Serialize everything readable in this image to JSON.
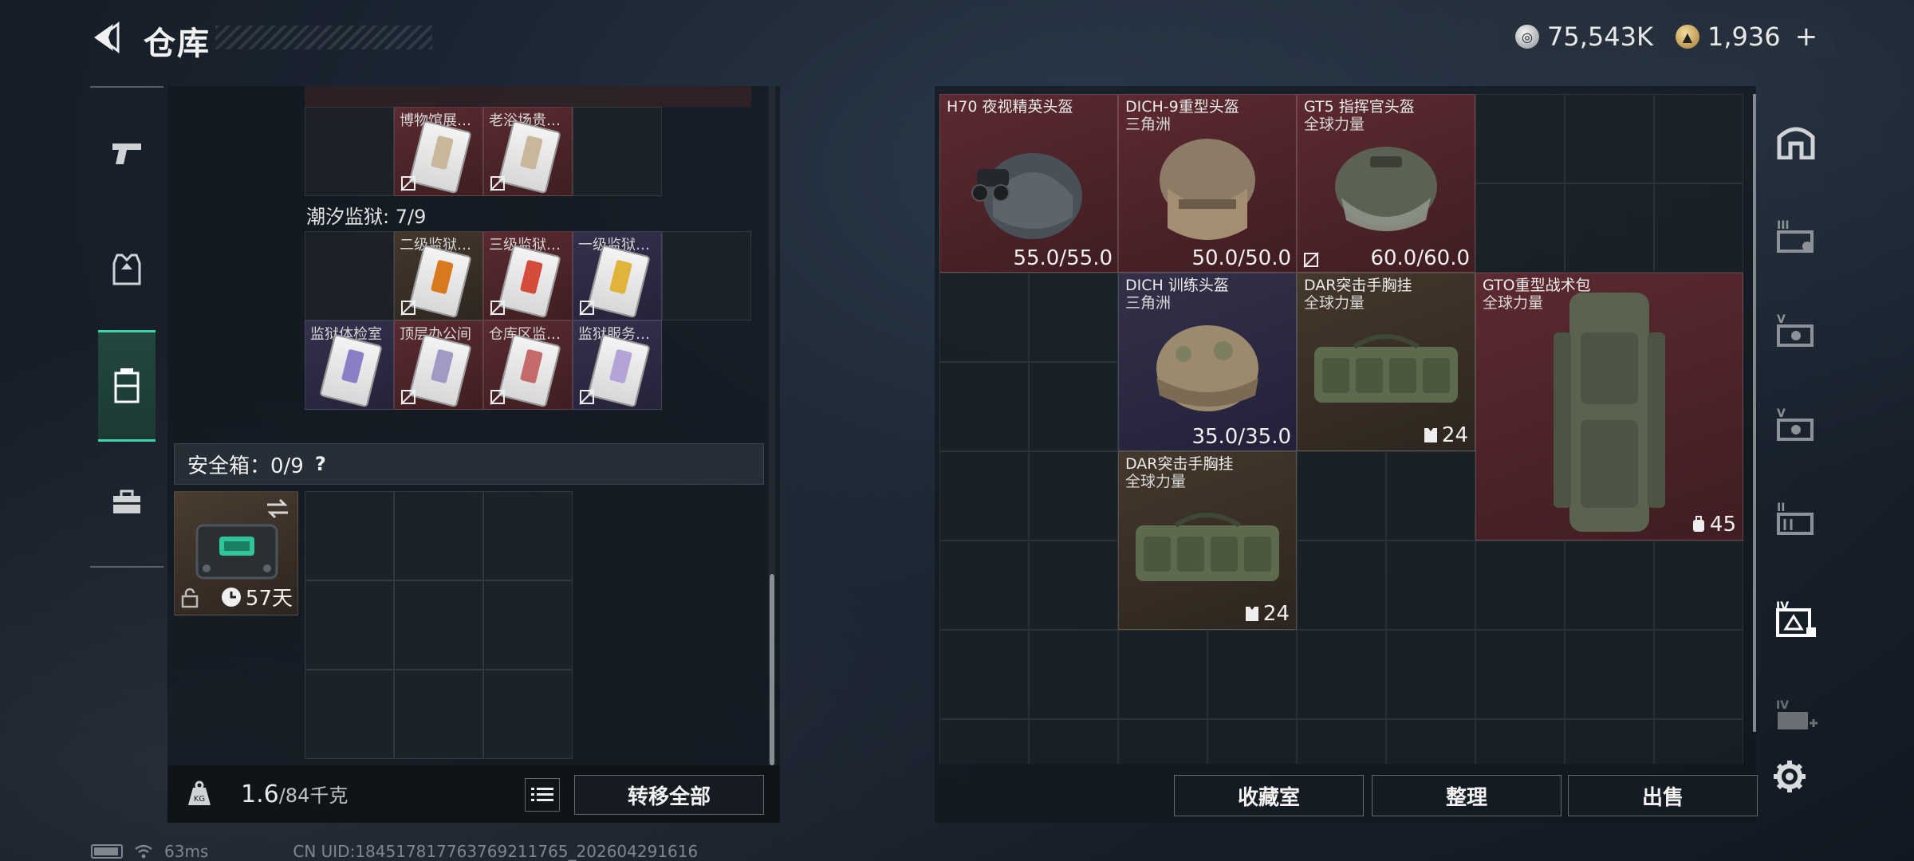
{
  "header": {
    "title": "仓库",
    "currency": [
      {
        "icon": "silver-coin-icon",
        "value": "75,543K"
      },
      {
        "icon": "gold-coin-icon",
        "value": "1,936"
      }
    ],
    "plus": "+"
  },
  "left_nav": [
    "weapons",
    "equipment",
    "storage",
    "toolbox"
  ],
  "storage": {
    "top_row": [
      {
        "name": "博物馆展…",
        "color": "red"
      },
      {
        "name": "老浴场贵…",
        "color": "red"
      }
    ],
    "prison_label": "潮汐监狱: 7/9",
    "prison_row1": [
      {
        "name": "二级监狱…",
        "color": "brown"
      },
      {
        "name": "三级监狱…",
        "color": "red"
      },
      {
        "name": "一级监狱…",
        "color": "purple"
      }
    ],
    "prison_row2": [
      {
        "name": "监狱体检室",
        "color": "purple"
      },
      {
        "name": "顶层办公间",
        "color": "red"
      },
      {
        "name": "仓库区监…",
        "color": "red"
      },
      {
        "name": "监狱服务…",
        "color": "purple"
      }
    ],
    "safebox": {
      "label": "安全箱：0/9",
      "help": "?",
      "days": "57天"
    }
  },
  "footer_left": {
    "weight_current": "1.6",
    "weight_max": "/84千克",
    "transfer_all": "转移全部"
  },
  "inventory": {
    "items": [
      {
        "name": "H70 夜视精英头盔",
        "sub": "",
        "value": "55.0/55.0",
        "color": "red",
        "kind": "helmet-nv"
      },
      {
        "name": "DICH-9重型头盔",
        "sub": "三角洲",
        "value": "50.0/50.0",
        "color": "red",
        "kind": "helmet-heavy"
      },
      {
        "name": "GT5 指挥官头盔",
        "sub": "全球力量",
        "value": "60.0/60.0",
        "color": "red",
        "kind": "helmet-cmd"
      },
      {
        "name": "DICH 训练头盔",
        "sub": "三角洲",
        "value": "35.0/35.0",
        "color": "purple",
        "kind": "helmet-train"
      },
      {
        "name": "DAR突击手胸挂",
        "sub": "全球力量",
        "value": "24",
        "color": "brown",
        "kind": "rig"
      },
      {
        "name": "GTO重型战术包",
        "sub": "全球力量",
        "value": "45",
        "color": "red",
        "kind": "backpack"
      },
      {
        "name": "DAR突击手胸挂",
        "sub": "全球力量",
        "value": "24",
        "color": "brown",
        "kind": "rig"
      }
    ]
  },
  "footer_right": {
    "collection": "收藏室",
    "sort": "整理",
    "sell": "出售"
  },
  "right_nav": [
    "home",
    "III",
    "V",
    "V",
    "II",
    "IV",
    "IV"
  ],
  "status": {
    "ping": "63ms",
    "uid": "CN UID:18451781776376921176​5_202604291616"
  }
}
